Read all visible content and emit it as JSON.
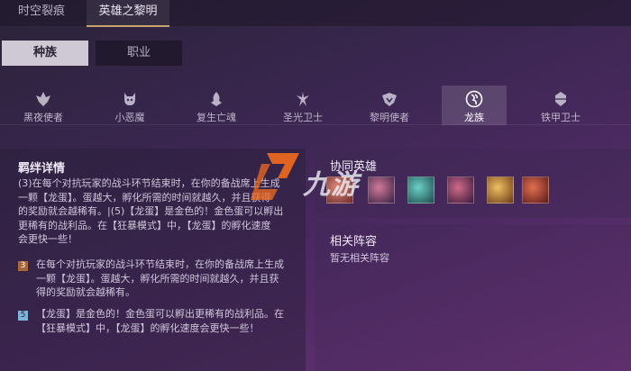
{
  "top_tabs": [
    "时空裂痕",
    "英雄之黎明"
  ],
  "segments": [
    "种族",
    "职业"
  ],
  "races": [
    {
      "label": "黑夜使者",
      "icon": "night-icon"
    },
    {
      "label": "小恶魔",
      "icon": "imp-icon"
    },
    {
      "label": "复生亡魂",
      "icon": "revenant-icon"
    },
    {
      "label": "圣光卫士",
      "icon": "lightbringer-icon"
    },
    {
      "label": "黎明使者",
      "icon": "dawnbringer-icon"
    },
    {
      "label": "龙族",
      "icon": "dragon-icon"
    },
    {
      "label": "铁甲卫士",
      "icon": "ironclad-icon"
    }
  ],
  "synergy": {
    "title": "羁绊详情",
    "summary_lines": [
      "(3)在每个对抗玩家的战斗环节结束时，在你的备战席上生成",
      "一颗【龙蛋】。蛋越大，孵化所需的时间就越久，并且获得",
      "的奖励就会越稀有。|(5)【龙蛋】是金色的！金色蛋可以孵出",
      "更稀有的战利品。在【狂暴模式】中，【龙蛋】的孵化速度",
      "会更快一些！"
    ],
    "tiers": [
      {
        "level": "3",
        "lines": [
          "在每个对抗玩家的战斗环节结束时，在你的备战席上生成",
          "一颗【龙蛋】。蛋越大，孵化所需的时间就越久，并且获",
          "得的奖励就会越稀有。"
        ]
      },
      {
        "level": "5",
        "lines": [
          "【龙蛋】是金色的！金色蛋可以孵出更稀有的战利品。在",
          "【狂暴模式】中，【龙蛋】的孵化速度会更快一些！"
        ]
      }
    ]
  },
  "heroes": {
    "title": "协同英雄",
    "colors": [
      "#b84a4a",
      "#6a4a8a",
      "#2f7a7a",
      "#7a3a5a",
      "#c8843a",
      "#9a3a2a"
    ]
  },
  "related": {
    "title": "相关阵容",
    "empty_text": "暂无相关阵容"
  },
  "watermark": {
    "text": "九游",
    "accent": "#f26b1d"
  }
}
